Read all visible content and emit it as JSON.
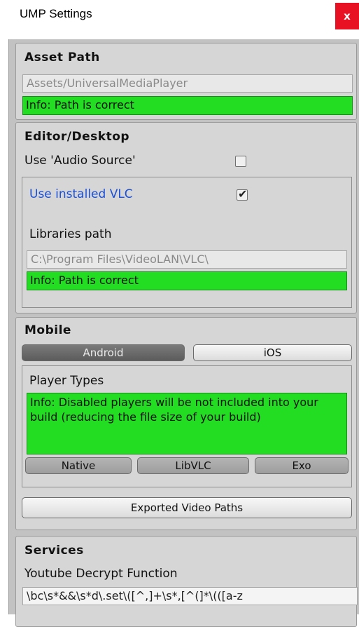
{
  "window": {
    "title": "UMP Settings",
    "close_symbol": "x"
  },
  "asset_path": {
    "heading": "Asset Path",
    "path_value": "Assets/UniversalMediaPlayer",
    "info": "Info: Path is correct"
  },
  "editor_desktop": {
    "heading": "Editor/Desktop",
    "use_audio_source_label": "Use 'Audio Source'",
    "use_audio_source_checked": false,
    "use_installed_vlc_label": "Use installed VLC",
    "use_installed_vlc_checked": true,
    "libraries_path_label": "Libraries path",
    "libraries_path_value": "C:\\Program Files\\VideoLAN\\VLC\\",
    "info": "Info: Path is correct"
  },
  "mobile": {
    "heading": "Mobile",
    "platform_tabs": [
      "Android",
      "iOS"
    ],
    "selected_platform": "Android",
    "player_types_label": "Player Types",
    "info": "Info: Disabled players will be not included into your build (reducing the file size of your build)",
    "players": [
      "Native",
      "LibVLC",
      "Exo"
    ],
    "exported_paths_button": "Exported Video Paths"
  },
  "services": {
    "heading": "Services",
    "youtube_label": "Youtube Decrypt Function",
    "youtube_value": "\\bc\\s*&&\\s*d\\.set\\([^,]+\\s*,[^(]*\\(([a-z"
  },
  "colors": {
    "info_green": "#22dd22",
    "link_blue": "#1a50d8",
    "close_red": "#e81123",
    "selected_tab": "#6a6a6a"
  }
}
